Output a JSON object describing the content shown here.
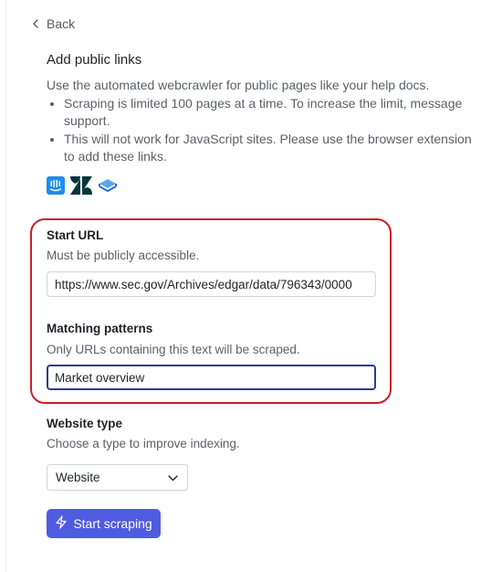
{
  "nav": {
    "back_label": "Back"
  },
  "section": {
    "title": "Add public links",
    "description": "Use the automated webcrawler for public pages like your help docs.",
    "bullets": [
      "Scraping is limited 100 pages at a time. To increase the limit, message support.",
      "This will not work for JavaScript sites. Please use the browser extension to add these links."
    ],
    "integrations": [
      "intercom-icon",
      "zendesk-icon",
      "knowledge-base-icon"
    ]
  },
  "start_url": {
    "label": "Start URL",
    "help": "Must be publicly accessible.",
    "value": "https://www.sec.gov/Archives/edgar/data/796343/0000"
  },
  "matching_patterns": {
    "label": "Matching patterns",
    "help": "Only URLs containing this text will be scraped.",
    "value": "Market overview"
  },
  "website_type": {
    "label": "Website type",
    "help": "Choose a type to improve indexing.",
    "selected": "Website"
  },
  "actions": {
    "start_label": "Start scraping"
  },
  "colors": {
    "primary": "#4f5ce0",
    "highlight": "#cc1f2a",
    "focus_border": "#2f3a8f",
    "intercom": "#1f8ded",
    "zendesk": "#03363d"
  }
}
